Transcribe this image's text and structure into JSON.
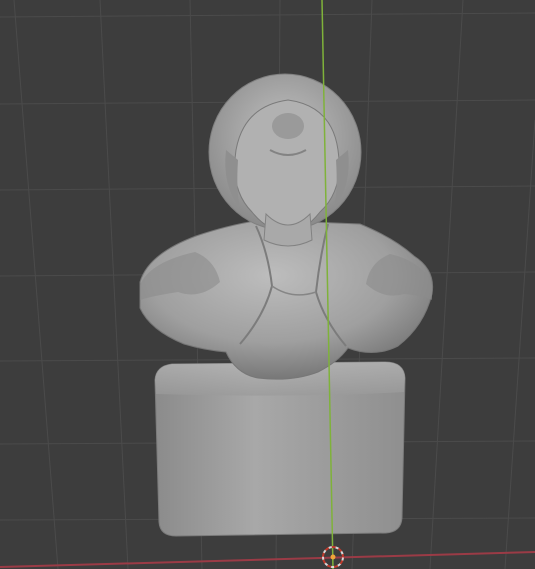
{
  "viewport": {
    "background_color": "#3d3d3d",
    "grid_color": "#4a4a4a",
    "axis_x_color": "#9b3b46",
    "axis_z_color": "#7fb23a",
    "model_color": "#a3a3a3",
    "origin_color": "#f0a63a"
  },
  "objects": [
    {
      "name": "sculpture-bust",
      "kind": "mesh"
    },
    {
      "name": "pedestal-block",
      "kind": "mesh"
    }
  ],
  "gizmos": {
    "cursor": "3d-cursor-icon"
  }
}
